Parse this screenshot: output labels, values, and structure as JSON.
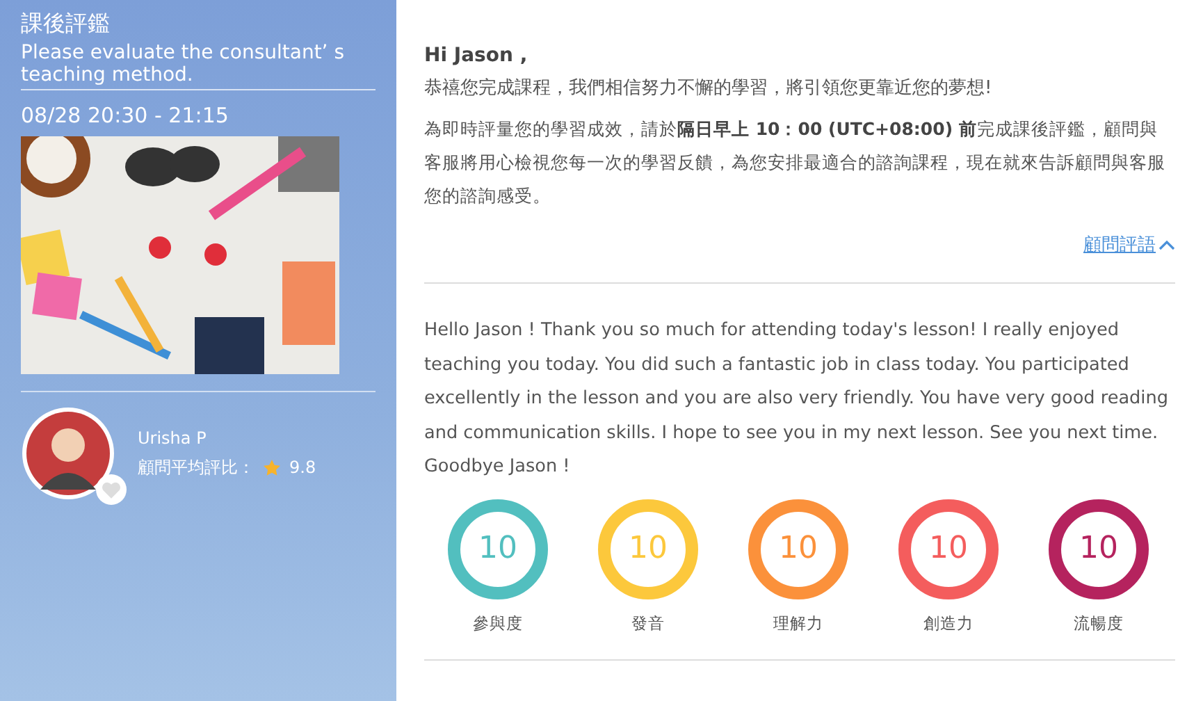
{
  "sidebar": {
    "title": "課後評鑑",
    "subtitle": "Please evaluate the consultant’ s teaching method.",
    "time": "08/28 20:30 - 21:15",
    "consultant": {
      "name": "Urisha P",
      "rating_label": "顧問平均評比：",
      "rating": "9.8"
    }
  },
  "main": {
    "greeting": "Hi Jason ,",
    "congrats": "恭禧您完成課程，我們相信努力不懈的學習，將引領您更靠近您的夢想!",
    "notice": "為即時評量您的學習成效，請於**隔日早上 10：00 (UTC+08:00) 前**完成課後評鑑，顧問與客服將用心檢視您每一次的學習反饋，為您安排最適合的諮詢課程，現在就來告訴顧問與客服您的諮詢感受。",
    "comment_toggle": {
      "label": "顧問評語",
      "expanded": true
    },
    "comment": "Hello Jason ! Thank you so much for attending today's lesson! I really enjoyed teaching you today. You did such a fantastic job in class today. You participated excellently in the lesson and you are also very friendly. You have very good reading and communication skills. I hope to see you in my next lesson. See you next time. Goodbye Jason !",
    "scores": [
      {
        "value": "10",
        "label": "參與度",
        "color": "#52bfbf"
      },
      {
        "value": "10",
        "label": "發音",
        "color": "#fcc83c"
      },
      {
        "value": "10",
        "label": "理解力",
        "color": "#fb913b"
      },
      {
        "value": "10",
        "label": "創造力",
        "color": "#f45d5d"
      },
      {
        "value": "10",
        "label": "流暢度",
        "color": "#b5235e"
      }
    ]
  }
}
